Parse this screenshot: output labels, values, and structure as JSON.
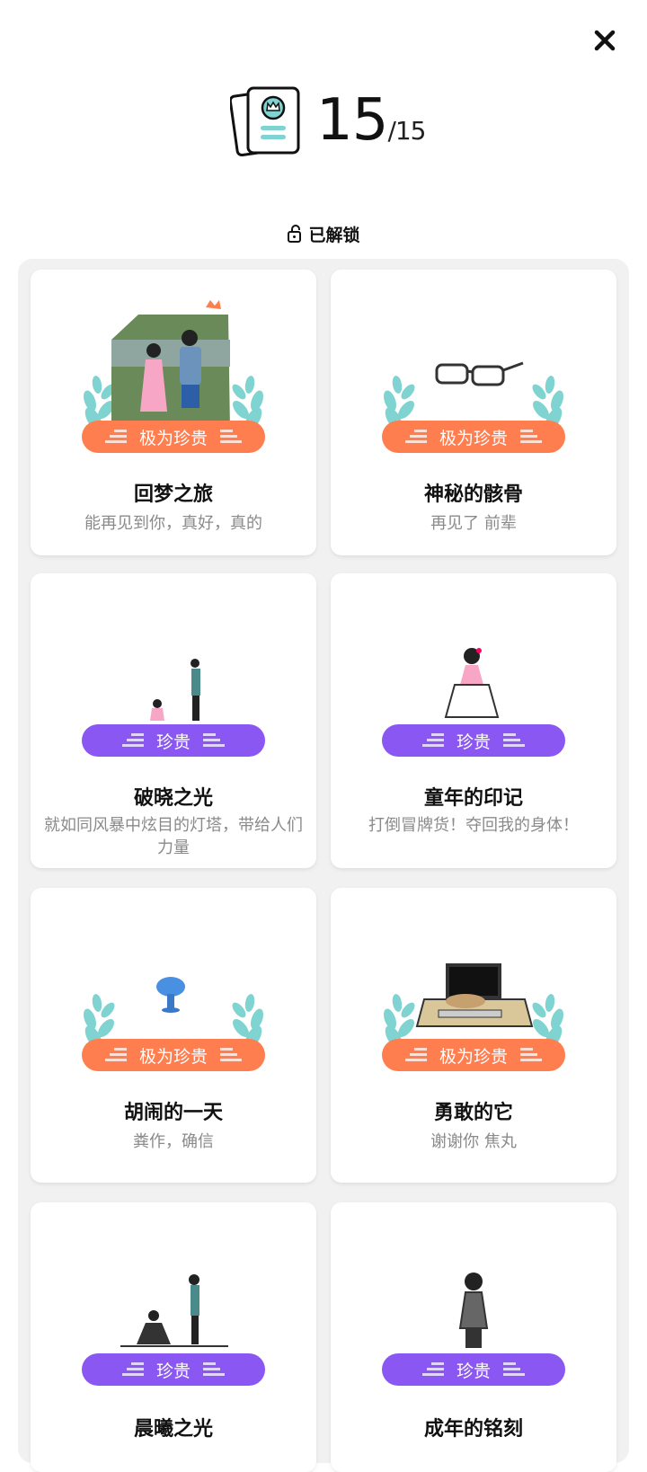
{
  "header": {
    "count": "15",
    "total": "/15",
    "unlocked_label": "已解锁"
  },
  "cards": [
    {
      "title": "回梦之旅",
      "desc": "能再见到你，真好，真的",
      "rarity": "极为珍贵"
    },
    {
      "title": "神秘的骸骨",
      "desc": "再见了 前辈",
      "rarity": "极为珍贵"
    },
    {
      "title": "破晓之光",
      "desc": "就如同风暴中炫目的灯塔，带给人们力量",
      "rarity": "珍贵"
    },
    {
      "title": "童年的印记",
      "desc": "打倒冒牌货！夺回我的身体！",
      "rarity": "珍贵"
    },
    {
      "title": "胡闹的一天",
      "desc": "粪作，确信",
      "rarity": "极为珍贵"
    },
    {
      "title": "勇敢的它",
      "desc": "谢谢你 焦丸",
      "rarity": "极为珍贵"
    },
    {
      "title": "晨曦之光",
      "desc": "",
      "rarity": "珍贵"
    },
    {
      "title": "成年的铭刻",
      "desc": "",
      "rarity": "珍贵"
    }
  ],
  "colors": {
    "very_precious": "#ff7e4f",
    "precious": "#8b57f2",
    "laurel": "#7fd3d0"
  },
  "icons": [
    "close-icon",
    "card-book-icon",
    "unlock-icon",
    "laurel-icon",
    "badge-bars-icon"
  ]
}
